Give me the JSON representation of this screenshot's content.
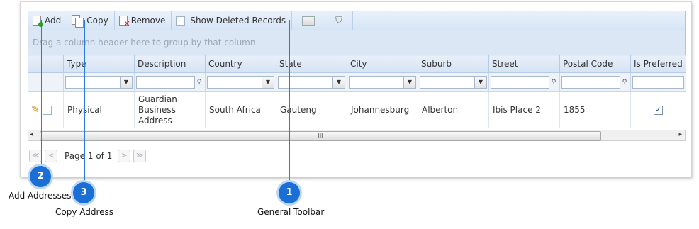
{
  "toolbar": {
    "add": "Add",
    "copy": "Copy",
    "remove": "Remove",
    "show_deleted": "Show Deleted Records"
  },
  "group_hint": "Drag a column header here to group by that column",
  "columns": [
    "Type",
    "Description",
    "Country",
    "State",
    "City",
    "Suburb",
    "Street",
    "Postal Code",
    "Is Preferred"
  ],
  "rows": [
    {
      "type": "Physical",
      "description": "Guardian Business Address",
      "country": "South Africa",
      "state": "Gauteng",
      "city": "Johannesburg",
      "suburb": "Alberton",
      "street": "Ibis Place 2",
      "postal_code": "1855",
      "is_preferred": "✓"
    }
  ],
  "scroll_thumb": "III",
  "pager": {
    "text": "Page 1 of 1",
    "first": "≪",
    "prev": "<",
    "next": ">",
    "last": "≫"
  },
  "callouts": [
    {
      "number": "1",
      "label": "General Toolbar"
    },
    {
      "number": "2",
      "label": "Add Addresses"
    },
    {
      "number": "3",
      "label": "Copy Address"
    }
  ],
  "colors": {
    "badge": "#1a6fd6",
    "line": "#2b7bd8",
    "toolbar": "#d6e5f6"
  }
}
